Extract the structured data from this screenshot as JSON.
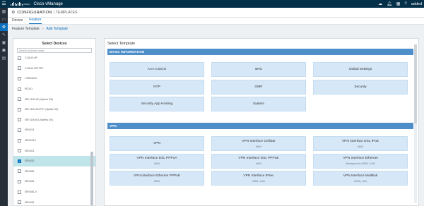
{
  "topbar": {
    "logo_word": "CISCO",
    "app_title": "Cisco vManage",
    "user": "added",
    "icons": [
      "menu-icon",
      "cloud-icon",
      "bell-icon",
      "tasks-icon",
      "help-icon"
    ]
  },
  "sidebar": {
    "items": [
      {
        "icon": "dashboard-icon",
        "active": false
      },
      {
        "icon": "monitor-icon",
        "active": false
      },
      {
        "icon": "gear-icon",
        "active": true
      },
      {
        "icon": "wrench-icon",
        "active": false
      },
      {
        "icon": "toolbox-icon",
        "active": false
      },
      {
        "icon": "users-icon",
        "active": false
      },
      {
        "icon": "analytics-icon",
        "active": false
      }
    ]
  },
  "breadcrumb": {
    "section": "CONFIGURATION",
    "sub": "TEMPLATES"
  },
  "tabs": [
    {
      "label": "Device",
      "active": false
    },
    {
      "label": "Feature",
      "active": true
    }
  ],
  "subbar": {
    "item1": "Feature Template",
    "sep": "›",
    "item2": "Add Template"
  },
  "devices": {
    "title": "Select Devices",
    "search_placeholder": "Search by device name",
    "items": [
      {
        "name": "C1161X-8P",
        "checked": false
      },
      {
        "name": "C1161X-8PLTEP",
        "checked": false
      },
      {
        "name": "CSR1000V",
        "checked": false
      },
      {
        "name": "IR1101",
        "checked": false
      },
      {
        "name": "ISR 1100 4G (Viptela OS)",
        "checked": false
      },
      {
        "name": "ISR 1100 4GLTE* (Viptela OS)",
        "checked": false
      },
      {
        "name": "ISR 1100 6G (Viptela OS)",
        "checked": false
      },
      {
        "name": "ISR4221",
        "checked": false
      },
      {
        "name": "ISR4221X",
        "checked": false
      },
      {
        "name": "ISR4321",
        "checked": false
      },
      {
        "name": "ISR4331",
        "checked": true
      },
      {
        "name": "ISR4351",
        "checked": false
      },
      {
        "name": "ISR4431",
        "checked": false
      },
      {
        "name": "ISR4451-X",
        "checked": false
      },
      {
        "name": "ISR4461",
        "checked": false
      }
    ]
  },
  "template": {
    "title": "Select Template",
    "sections": [
      {
        "heading": "BASIC INFORMATION",
        "cards": [
          {
            "title": "AAA-CISCO",
            "sub": ""
          },
          {
            "title": "BFD",
            "sub": ""
          },
          {
            "title": "Global Settings",
            "sub": ""
          },
          {
            "title": "NTP",
            "sub": ""
          },
          {
            "title": "OMP",
            "sub": ""
          },
          {
            "title": "Security",
            "sub": ""
          },
          {
            "title": "Security App Hosting",
            "sub": ""
          },
          {
            "title": "System",
            "sub": ""
          }
        ]
      },
      {
        "heading": "VPN",
        "cards": [
          {
            "title": "VPN",
            "sub": ""
          },
          {
            "title": "VPN Interface Cellular",
            "sub": "WAN"
          },
          {
            "title": "VPN Interface DSL IPoE",
            "sub": "WAN"
          },
          {
            "title": "VPN Interface DSL PPPoA",
            "sub": "WAN"
          },
          {
            "title": "VPN Interface DSL PPPoE",
            "sub": "WAN"
          },
          {
            "title": "VPN Interface Ethernet",
            "sub": "Management | WAN | LAN"
          },
          {
            "title": "VPN Interface Ethernet PPPoE",
            "sub": "WAN"
          },
          {
            "title": "VPN Interface IPsec",
            "sub": "WAN | LAN"
          },
          {
            "title": "VPN Interface Multilink",
            "sub": "WAN | LAN"
          }
        ]
      }
    ]
  }
}
